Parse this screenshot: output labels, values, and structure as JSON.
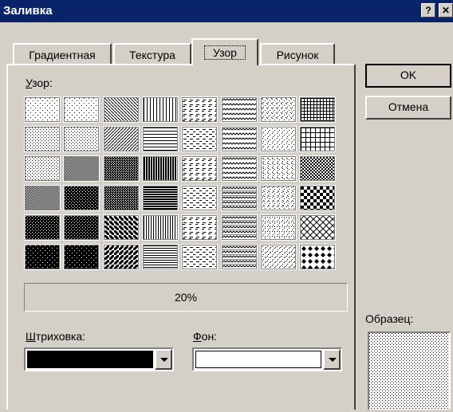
{
  "window": {
    "title": "Заливка",
    "help_glyph": "?",
    "close_glyph": "✕"
  },
  "tabs": [
    {
      "label": "Градиентная"
    },
    {
      "label": "Текстура"
    },
    {
      "label": "Узор"
    },
    {
      "label": "Рисунок"
    }
  ],
  "active_tab": 2,
  "pattern_section": {
    "label_first": "У",
    "label_rest": "зор:"
  },
  "patterns": [
    "dots-5",
    "dots-10",
    "lt-down-diag",
    "lt-vertical",
    "dashed-down-diag",
    "small-wave",
    "small-confetti",
    "small-grid",
    "dots-20",
    "dots-25",
    "lt-up-diag",
    "lt-horizontal",
    "dashed-up-diag",
    "wave",
    "large-confetti",
    "large-grid",
    "dots-30",
    "dots-40",
    "dk-down-diag",
    "dk-vertical",
    "dashed-horizontal",
    "zigzag",
    "dotted-grid",
    "sm-checker",
    "dots-50",
    "dots-60",
    "dk-up-diag",
    "dk-horizontal",
    "small-brick",
    "horiz-brick",
    "weave",
    "lg-checker",
    "dots-70",
    "dots-75",
    "wd-down-diag",
    "narrow-vertical",
    "sm-dots-sparse",
    "diag-brick",
    "divot",
    "outlined-diamond",
    "dots-80",
    "dots-90",
    "wd-up-diag",
    "narrow-horizontal",
    "large-dots",
    "plaid",
    "shingle",
    "solid-diamond"
  ],
  "selected_pattern_label": "20%",
  "foreground": {
    "label_first": "Ш",
    "label_rest": "триховка:",
    "color": "#000000"
  },
  "background": {
    "label_first": "Ф",
    "label_rest": "он:",
    "color": "#ffffff"
  },
  "buttons": {
    "ok": "OK",
    "cancel": "Отмена"
  },
  "sample": {
    "label": "Образец:"
  },
  "colors": {
    "title_bar": "#0a246a",
    "face": "#d4d0c8"
  }
}
